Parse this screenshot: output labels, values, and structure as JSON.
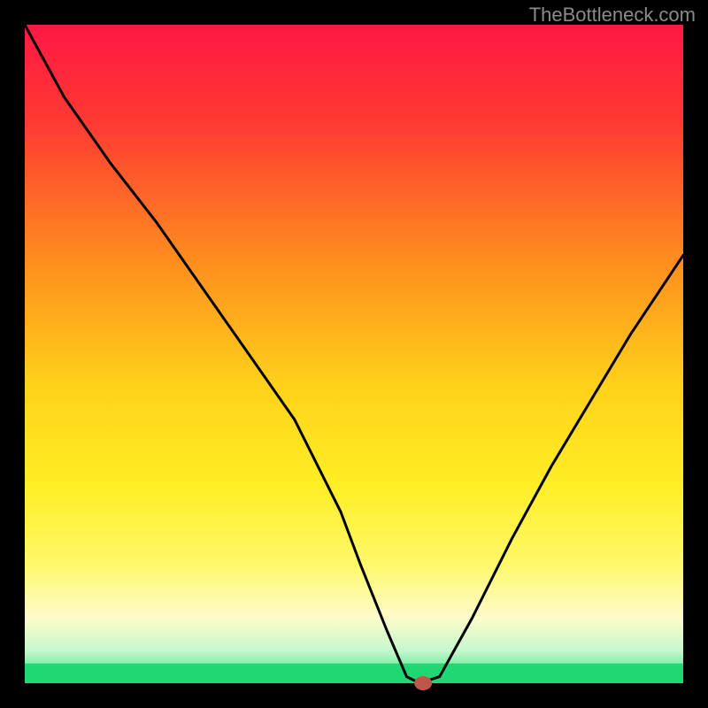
{
  "watermark": "TheBottleneck.com",
  "chart_data": {
    "type": "line",
    "title": "",
    "xlabel": "",
    "ylabel": "",
    "xlim": [
      0,
      100
    ],
    "ylim": [
      0,
      100
    ],
    "grid": false,
    "series": [
      {
        "name": "curve",
        "x": [
          0,
          6,
          13,
          20,
          27,
          34,
          41,
          48,
          51,
          55,
          58,
          60,
          63,
          68,
          74,
          80,
          86,
          92,
          100
        ],
        "y": [
          100,
          89,
          79,
          70,
          60,
          50,
          40,
          26,
          18,
          8,
          1,
          0,
          1,
          10,
          22,
          33,
          43,
          53,
          65
        ]
      }
    ],
    "marker": {
      "x": 60.5,
      "y": 0
    },
    "bottom_band": {
      "y": 0,
      "height": 3
    },
    "gradient_stops": [
      {
        "offset": 0.0,
        "color": "#ff1844"
      },
      {
        "offset": 0.15,
        "color": "#ff3a33"
      },
      {
        "offset": 0.35,
        "color": "#ff8a1f"
      },
      {
        "offset": 0.55,
        "color": "#ffd21a"
      },
      {
        "offset": 0.7,
        "color": "#ffee25"
      },
      {
        "offset": 0.82,
        "color": "#fff86a"
      },
      {
        "offset": 0.9,
        "color": "#fdfccb"
      },
      {
        "offset": 0.95,
        "color": "#c6f8cc"
      },
      {
        "offset": 1.0,
        "color": "#27e07a"
      }
    ]
  }
}
